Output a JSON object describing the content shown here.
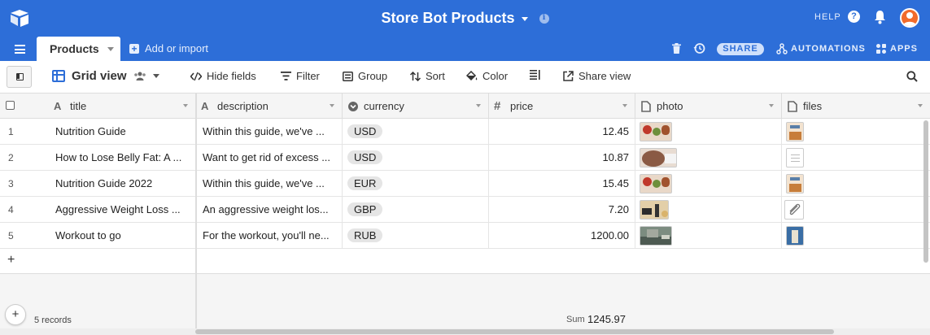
{
  "header": {
    "app_title": "Store Bot Products",
    "help_label": "HELP"
  },
  "tabbar": {
    "active_tab": "Products",
    "add_import_label": "Add or import",
    "share_label": "SHARE",
    "automations_label": "AUTOMATIONS",
    "apps_label": "APPS"
  },
  "toolbar": {
    "view_name": "Grid view",
    "hide_fields": "Hide fields",
    "filter": "Filter",
    "group": "Group",
    "sort": "Sort",
    "color": "Color",
    "share_view": "Share view"
  },
  "columns": [
    {
      "name": "title",
      "icon": "text-icon"
    },
    {
      "name": "description",
      "icon": "text-icon"
    },
    {
      "name": "currency",
      "icon": "single-select-icon"
    },
    {
      "name": "price",
      "icon": "number-icon"
    },
    {
      "name": "photo",
      "icon": "attachment-icon"
    },
    {
      "name": "files",
      "icon": "attachment-icon"
    }
  ],
  "rows": [
    {
      "num": "1",
      "title": "Nutrition Guide",
      "description": "Within this guide, we've ...",
      "currency": "USD",
      "price": "12.45"
    },
    {
      "num": "2",
      "title": "How to Lose Belly Fat: A ...",
      "description": "Want to get rid of excess ...",
      "currency": "USD",
      "price": "10.87"
    },
    {
      "num": "3",
      "title": "Nutrition Guide 2022",
      "description": "Within this guide, we've ...",
      "currency": "EUR",
      "price": "15.45"
    },
    {
      "num": "4",
      "title": "Aggressive Weight Loss ...",
      "description": "An aggressive weight los...",
      "currency": "GBP",
      "price": "7.20"
    },
    {
      "num": "5",
      "title": "Workout to go",
      "description": "For the workout, you'll ne...",
      "currency": "RUB",
      "price": "1200.00"
    }
  ],
  "footer": {
    "records": "5 records",
    "sum_label": "Sum",
    "sum_value": "1245.97"
  },
  "colors": {
    "brand": "#2d6ed8",
    "pill": "#e5e5e5"
  }
}
